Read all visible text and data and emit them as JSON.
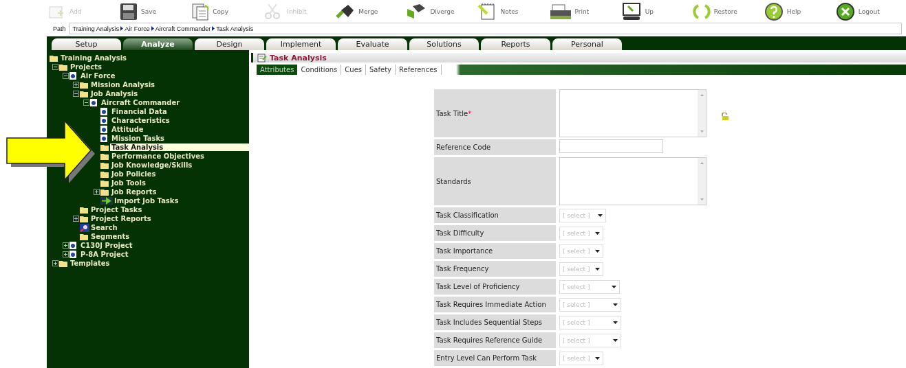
{
  "toolbar": [
    {
      "kind": "add",
      "label": "Add",
      "disabled": true
    },
    {
      "kind": "save",
      "label": "Save",
      "disabled": false
    },
    {
      "kind": "copy",
      "label": "Copy",
      "disabled": false
    },
    {
      "kind": "cut",
      "label": "Inhibit",
      "disabled": true
    },
    {
      "kind": "merge",
      "label": "Merge",
      "disabled": false
    },
    {
      "kind": "diverge",
      "label": "Diverge",
      "disabled": false
    },
    {
      "kind": "notes",
      "label": "Notes",
      "disabled": false
    },
    {
      "kind": "print",
      "label": "Print",
      "disabled": false
    },
    {
      "kind": "up",
      "label": "Up",
      "disabled": false
    },
    {
      "kind": "restore",
      "label": "Restore",
      "disabled": false
    },
    {
      "kind": "help",
      "label": "Help",
      "disabled": false
    },
    {
      "kind": "logout",
      "label": "Logout",
      "disabled": false
    }
  ],
  "path": {
    "label": "Path",
    "crumbs": [
      "Training Analysis",
      "Air Force",
      "Aircraft Commander",
      "Task Analysis"
    ]
  },
  "tabs": [
    {
      "label": "Setup",
      "selected": false
    },
    {
      "label": "Analyze",
      "selected": true
    },
    {
      "label": "Design",
      "selected": false
    },
    {
      "label": "Implement",
      "selected": false
    },
    {
      "label": "Evaluate",
      "selected": false
    },
    {
      "label": "Solutions",
      "selected": false
    },
    {
      "label": "Reports",
      "selected": false
    },
    {
      "label": "Personal",
      "selected": false
    }
  ],
  "tree": [
    {
      "label": "Training Analysis",
      "kind": "folder",
      "selected": false,
      "children": [
        {
          "label": "Projects",
          "kind": "folder",
          "selected": false,
          "expanded": true,
          "children": [
            {
              "label": "Air Force",
              "kind": "doc",
              "selected": false,
              "expanded": true,
              "children": [
                {
                  "label": "Mission Analysis",
                  "kind": "folder",
                  "selected": false,
                  "expanded": false
                },
                {
                  "label": "Job Analysis",
                  "kind": "folder",
                  "selected": false,
                  "expanded": true,
                  "children": [
                    {
                      "label": "Aircraft Commander",
                      "kind": "doc",
                      "selected": false,
                      "expanded": true,
                      "children": [
                        {
                          "label": "Financial Data",
                          "kind": "doc",
                          "selected": false
                        },
                        {
                          "label": "Characteristics",
                          "kind": "doc",
                          "selected": false
                        },
                        {
                          "label": "Attitude",
                          "kind": "doc",
                          "selected": false
                        },
                        {
                          "label": "Mission Tasks",
                          "kind": "doc",
                          "selected": false
                        },
                        {
                          "label": "Task Analysis",
                          "kind": "folder",
                          "selected": true
                        },
                        {
                          "label": "Performance Objectives",
                          "kind": "folder",
                          "selected": false
                        },
                        {
                          "label": "Job Knowledge/Skills",
                          "kind": "folder",
                          "selected": false
                        },
                        {
                          "label": "Job Policies",
                          "kind": "folder",
                          "selected": false
                        },
                        {
                          "label": "Job Tools",
                          "kind": "folder",
                          "selected": false
                        },
                        {
                          "label": "Job Reports",
                          "kind": "folder",
                          "selected": false,
                          "expanded": false
                        },
                        {
                          "label": "Import Job Tasks",
                          "kind": "import",
                          "selected": false
                        }
                      ]
                    }
                  ]
                },
                {
                  "label": "Project Tasks",
                  "kind": "folder",
                  "selected": false
                },
                {
                  "label": "Project Reports",
                  "kind": "folder",
                  "selected": false,
                  "expanded": false
                },
                {
                  "label": "Search",
                  "kind": "search",
                  "selected": false
                },
                {
                  "label": "Segments",
                  "kind": "folder",
                  "selected": false
                }
              ]
            },
            {
              "label": "C130J Project",
              "kind": "doc",
              "selected": false,
              "expanded": false
            },
            {
              "label": "P-8A Project",
              "kind": "doc",
              "selected": false,
              "expanded": false
            }
          ]
        },
        {
          "label": "Templates",
          "kind": "folder",
          "selected": false,
          "expanded": false
        }
      ]
    }
  ],
  "panel": {
    "title": "Task Analysis",
    "subtabs": [
      {
        "label": "Attributes",
        "selected": true
      },
      {
        "label": "Conditions",
        "selected": false
      },
      {
        "label": "Cues",
        "selected": false
      },
      {
        "label": "Safety",
        "selected": false
      },
      {
        "label": "References",
        "selected": false
      }
    ],
    "fields": [
      {
        "kind": "textarea",
        "label": "Task Title",
        "required_mark": "*",
        "lock": true
      },
      {
        "kind": "text",
        "label": "Reference Code"
      },
      {
        "kind": "textarea",
        "label": "Standards"
      },
      {
        "kind": "select",
        "label": "Task Classification",
        "value": "[ select ]"
      },
      {
        "kind": "select",
        "label": "Task Difficulty",
        "value": "[ select ]"
      },
      {
        "kind": "select",
        "label": "Task Importance",
        "value": "[ select ]"
      },
      {
        "kind": "select",
        "label": "Task Frequency",
        "value": "[ select ]"
      },
      {
        "kind": "select",
        "label": "Task Level of Proficiency",
        "value": "[ select ]"
      },
      {
        "kind": "select",
        "label": "Task Requires Immediate Action",
        "value": "[ select ]"
      },
      {
        "kind": "select",
        "label": "Task Includes Sequential Steps",
        "value": "[ select ]"
      },
      {
        "kind": "select",
        "label": "Task Requires Reference Guide",
        "value": "[ select ]"
      },
      {
        "kind": "select",
        "label": "Entry Level Can Perform Task",
        "value": "[ select ]"
      }
    ]
  }
}
